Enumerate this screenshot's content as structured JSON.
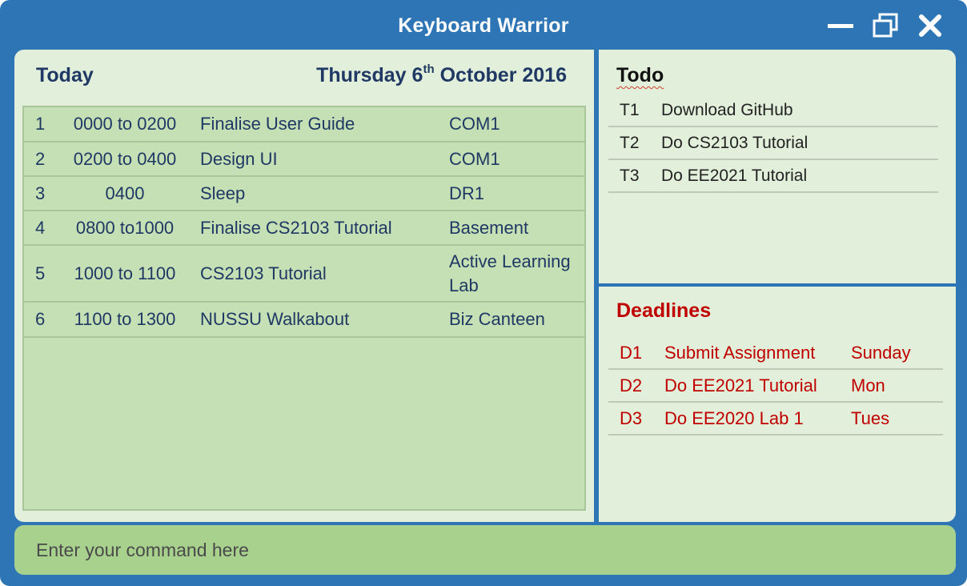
{
  "window": {
    "title": "Keyboard Warrior",
    "controls": {
      "minimize_icon": "minimize-icon",
      "maximize_icon": "restore-icon",
      "close_icon": "close-icon"
    }
  },
  "today": {
    "title": "Today",
    "date": {
      "weekday": "Thursday",
      "day": "6",
      "suffix": "th",
      "rest": "October 2016"
    },
    "rows": [
      {
        "index": "1",
        "time": "0000 to 0200",
        "task": "Finalise User Guide",
        "location": "COM1"
      },
      {
        "index": "2",
        "time": "0200 to 0400",
        "task": "Design UI",
        "location": "COM1"
      },
      {
        "index": "3",
        "time": "0400",
        "task": "Sleep",
        "location": "DR1"
      },
      {
        "index": "4",
        "time": "0800 to1000",
        "task": "Finalise CS2103 Tutorial",
        "location": "Basement"
      },
      {
        "index": "5",
        "time": "1000 to 1100",
        "task": "CS2103 Tutorial",
        "location": "Active Learning Lab"
      },
      {
        "index": "6",
        "time": "1100 to 1300",
        "task": "NUSSU Walkabout",
        "location": "Biz Canteen"
      }
    ]
  },
  "todo": {
    "title": "Todo",
    "items": [
      {
        "index": "T1",
        "text": "Download GitHub"
      },
      {
        "index": "T2",
        "text": "Do CS2103 Tutorial"
      },
      {
        "index": "T3",
        "text": "Do EE2021 Tutorial"
      }
    ]
  },
  "deadlines": {
    "title": "Deadlines",
    "items": [
      {
        "index": "D1",
        "text": "Submit Assignment",
        "due": "Sunday"
      },
      {
        "index": "D2",
        "text": "Do EE2021 Tutorial",
        "due": "Mon"
      },
      {
        "index": "D3",
        "text": "Do EE2020 Lab 1",
        "due": "Tues"
      }
    ]
  },
  "command": {
    "placeholder": "Enter your command here",
    "value": ""
  },
  "colors": {
    "frame": "#2e75b6",
    "panel": "#e2efda",
    "schedule": "#c5e0b4",
    "command_bar": "#a9d18e",
    "heading": "#1f3864",
    "deadline": "#c00000"
  }
}
